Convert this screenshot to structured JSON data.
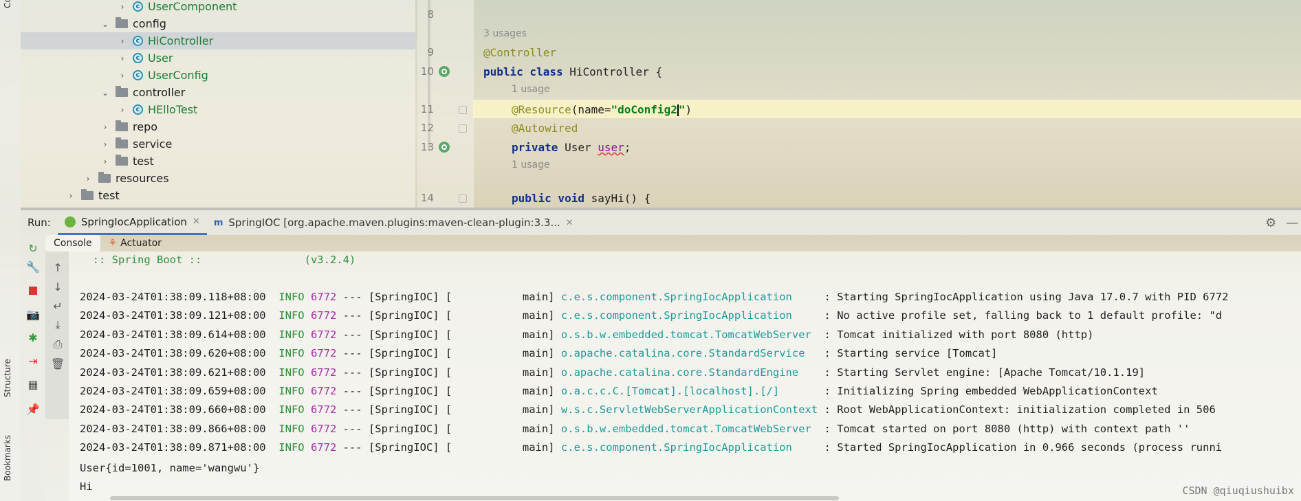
{
  "sidebar": {
    "top_label": "Co",
    "structure_label": "Structure",
    "bookmarks_label": "Bookmarks"
  },
  "project_tree": {
    "items": [
      {
        "label": "UserComponent",
        "kind": "class",
        "indent": 3
      },
      {
        "label": "config",
        "kind": "folder",
        "indent": 2,
        "expanded": true
      },
      {
        "label": "HiController",
        "kind": "class",
        "indent": 3,
        "selected": true
      },
      {
        "label": "User",
        "kind": "class",
        "indent": 3
      },
      {
        "label": "UserConfig",
        "kind": "class",
        "indent": 3
      },
      {
        "label": "controller",
        "kind": "folder",
        "indent": 2,
        "expanded": true
      },
      {
        "label": "HElloTest",
        "kind": "class",
        "indent": 3
      },
      {
        "label": "repo",
        "kind": "folder",
        "indent": 2
      },
      {
        "label": "service",
        "kind": "folder",
        "indent": 2
      },
      {
        "label": "test",
        "kind": "folder",
        "indent": 2
      },
      {
        "label": "resources",
        "kind": "folder",
        "indent": 1
      },
      {
        "label": "test",
        "kind": "folder",
        "indent": 0
      }
    ]
  },
  "editor": {
    "line_numbers": [
      "8",
      "9",
      "10",
      "11",
      "12",
      "13",
      "14"
    ],
    "hint_class_usages": "3 usages",
    "hint_field_usage": "1 usage",
    "hint_method_usage": "1 usage",
    "controller_annotation": "@Controller",
    "class_keywords": "public class",
    "class_name": " HiController {",
    "resource_annotation": "@Resource",
    "resource_param": "(name=",
    "resource_value": "\"doConfig2",
    "resource_value_end": "\"",
    "resource_close": ")",
    "autowired_annotation": "@Autowired",
    "private_keyword": "private",
    "field_type": " User ",
    "field_name": "user",
    "field_end": ";",
    "method_keywords": "public void",
    "method_name": " sayHi() {"
  },
  "run_panel": {
    "label": "Run:",
    "tabs": [
      {
        "label": "SpringIocApplication",
        "active": true
      },
      {
        "label": "SpringIOC [org.apache.maven.plugins:maven-clean-plugin:3.3...",
        "active": false
      }
    ],
    "subtabs": [
      "Console",
      "Actuator"
    ]
  },
  "console": {
    "banner": "  :: Spring Boot ::                (v3.2.4)",
    "logs": [
      {
        "ts": "2024-03-24T01:38:09.118+08:00",
        "level": "INFO",
        "pid": "6772",
        "app": " --- [SpringIOC] [           main] ",
        "logger": "c.e.s.component.SpringIocApplication    ",
        "msg": " : Starting SpringIocApplication using Java 17.0.7 with PID 6772"
      },
      {
        "ts": "2024-03-24T01:38:09.121+08:00",
        "level": "INFO",
        "pid": "6772",
        "app": " --- [SpringIOC] [           main] ",
        "logger": "c.e.s.component.SpringIocApplication    ",
        "msg": " : No active profile set, falling back to 1 default profile: \"d"
      },
      {
        "ts": "2024-03-24T01:38:09.614+08:00",
        "level": "INFO",
        "pid": "6772",
        "app": " --- [SpringIOC] [           main] ",
        "logger": "o.s.b.w.embedded.tomcat.TomcatWebServer ",
        "msg": " : Tomcat initialized with port 8080 (http)"
      },
      {
        "ts": "2024-03-24T01:38:09.620+08:00",
        "level": "INFO",
        "pid": "6772",
        "app": " --- [SpringIOC] [           main] ",
        "logger": "o.apache.catalina.core.StandardService  ",
        "msg": " : Starting service [Tomcat]"
      },
      {
        "ts": "2024-03-24T01:38:09.621+08:00",
        "level": "INFO",
        "pid": "6772",
        "app": " --- [SpringIOC] [           main] ",
        "logger": "o.apache.catalina.core.StandardEngine   ",
        "msg": " : Starting Servlet engine: [Apache Tomcat/10.1.19]"
      },
      {
        "ts": "2024-03-24T01:38:09.659+08:00",
        "level": "INFO",
        "pid": "6772",
        "app": " --- [SpringIOC] [           main] ",
        "logger": "o.a.c.c.C.[Tomcat].[localhost].[/]      ",
        "msg": " : Initializing Spring embedded WebApplicationContext"
      },
      {
        "ts": "2024-03-24T01:38:09.660+08:00",
        "level": "INFO",
        "pid": "6772",
        "app": " --- [SpringIOC] [           main] ",
        "logger": "w.s.c.ServletWebServerApplicationContext",
        "msg": " : Root WebApplicationContext: initialization completed in 506"
      },
      {
        "ts": "2024-03-24T01:38:09.866+08:00",
        "level": "INFO",
        "pid": "6772",
        "app": " --- [SpringIOC] [           main] ",
        "logger": "o.s.b.w.embedded.tomcat.TomcatWebServer ",
        "msg": " : Tomcat started on port 8080 (http) with context path ''"
      },
      {
        "ts": "2024-03-24T01:38:09.871+08:00",
        "level": "INFO",
        "pid": "6772",
        "app": " --- [SpringIOC] [           main] ",
        "logger": "c.e.s.component.SpringIocApplication    ",
        "msg": " : Started SpringIocApplication in 0.966 seconds (process runni"
      }
    ],
    "output_user": "User{id=1001, name='wangwu'}",
    "output_hi": "Hi"
  },
  "watermark": "CSDN @qiuqiushuibx"
}
